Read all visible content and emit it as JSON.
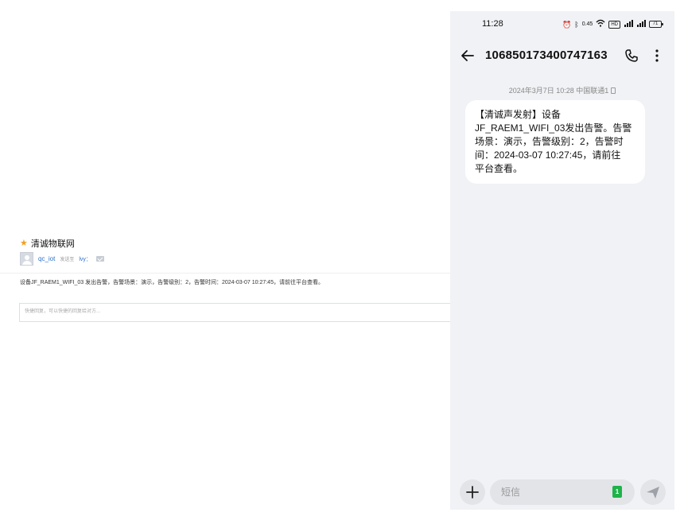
{
  "email": {
    "subject": "清诚物联网",
    "sender": "qc_iot",
    "to_label": "发送至",
    "recipient": "lvy：",
    "body": "设备JF_RAEM1_WIFI_03 发出告警，告警场景：演示，告警级别：2，告警时间：2024-03-07 10:27:45，请前往平台查看。",
    "reply_placeholder": "快捷回复，可以快捷的回复给对方..."
  },
  "phone": {
    "status": {
      "time": "11:28",
      "network_speed": "0.45",
      "battery": "71"
    },
    "header": {
      "number": "106850173400747163"
    },
    "conversation": {
      "date_line": "2024年3月7日 10:28 中国联通1",
      "message_lines": [
        "【清诚声发射】设备",
        "JF_RAEM1_WIFI_03发出告警。告警",
        "场景：演示，告警级别：2，告警时",
        "间：2024-03-07 10:27:45，请前往",
        "平台查看。"
      ]
    },
    "composer": {
      "placeholder": "短信",
      "sim_slot": "1"
    }
  },
  "colors": {
    "link": "#2a6fc9",
    "sim_green": "#1fb34a",
    "phone_bg": "#f1f2f5"
  },
  "icons": [
    "star-icon",
    "avatar-icon",
    "mail-icon",
    "alarm-icon",
    "bluetooth-icon",
    "wifi-icon",
    "signal-icon",
    "battery-icon",
    "back-arrow-icon",
    "phone-call-icon",
    "more-vert-icon",
    "plus-icon",
    "send-icon"
  ]
}
